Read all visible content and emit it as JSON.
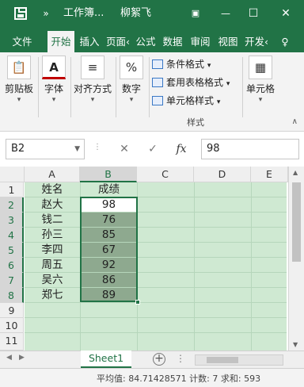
{
  "titlebar": {
    "title": "工作簿...",
    "user": "柳絮飞",
    "more": "»",
    "controls": {
      "ribbon_options": "▣",
      "minimize": "—",
      "maximize": "☐",
      "close": "✕"
    }
  },
  "tabs": [
    "文件",
    "开始",
    "插入",
    "页面‹",
    "公式",
    "数据",
    "审阅",
    "视图",
    "开发‹"
  ],
  "tabs_active": "开始",
  "tell_me": "♀",
  "ribbon": {
    "clipboard": {
      "label": "剪贴板",
      "icon": "📋"
    },
    "font": {
      "label": "字体",
      "icon": "A"
    },
    "alignment": {
      "label": "对齐方式",
      "icon": "≡"
    },
    "number": {
      "label": "数字",
      "icon": "%"
    },
    "styles_caption": "样式",
    "conditional_format": "条件格式",
    "table_format": "套用表格格式",
    "cell_styles": "单元格样式",
    "cells": {
      "label": "单元格",
      "icon": "▦"
    },
    "caret": "▾"
  },
  "formula_bar": {
    "name_box": "B2",
    "cancel": "✕",
    "confirm": "✓",
    "fx": "fx",
    "value": "98"
  },
  "grid": {
    "columns": [
      "A",
      "B",
      "C",
      "D",
      "E"
    ],
    "rows": [
      "1",
      "2",
      "3",
      "4",
      "5",
      "6",
      "7",
      "8",
      "9",
      "10",
      "11"
    ],
    "data": [
      [
        "姓名",
        "成绩"
      ],
      [
        "赵大",
        "98"
      ],
      [
        "钱二",
        "76"
      ],
      [
        "孙三",
        "85"
      ],
      [
        "李四",
        "67"
      ],
      [
        "周五",
        "92"
      ],
      [
        "吴六",
        "86"
      ],
      [
        "郑七",
        "89"
      ]
    ]
  },
  "sheet_tabs": {
    "active": "Sheet1",
    "add": "+"
  },
  "status": {
    "text": "平均值: 84.71428571   计数: 7   求和: 593"
  },
  "colors": {
    "excel_green": "#217346",
    "cell_fill": "#cfe9d2",
    "selection_fill": "#8ea98f"
  }
}
